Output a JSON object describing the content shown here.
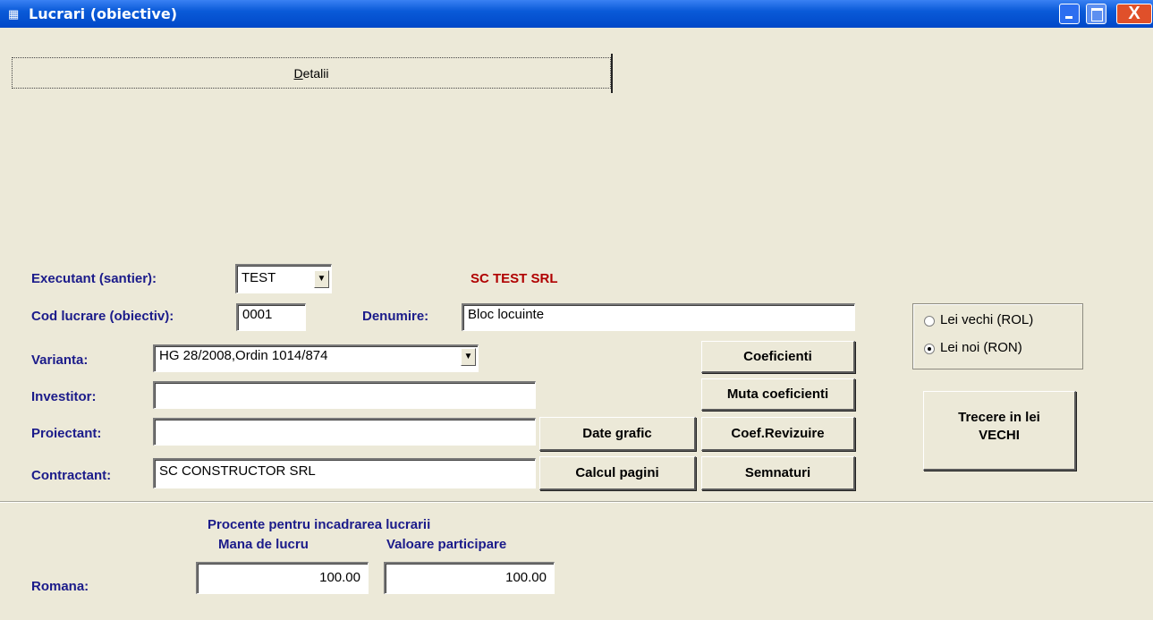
{
  "window": {
    "title": "Lucrari (obiective)",
    "icon": "app-icon",
    "close_glyph": "X"
  },
  "tab": {
    "label": "Detalii"
  },
  "form": {
    "executant_label": "Executant (santier):",
    "executant_value": "TEST",
    "company_name": "SC TEST SRL",
    "cod_label": "Cod lucrare (obiectiv):",
    "cod_value": "0001",
    "denumire_label": "Denumire:",
    "denumire_value": "Bloc locuinte",
    "varianta_label": "Varianta:",
    "varianta_value": "HG 28/2008,Ordin 1014/874",
    "investitor_label": "Investitor:",
    "investitor_value": "",
    "proiectant_label": "Proiectant:",
    "proiectant_value": "",
    "contractant_label": "Contractant:",
    "contractant_value": "SC CONSTRUCTOR SRL"
  },
  "buttons": {
    "coeficienti": "Coeficienti",
    "muta_coeficienti": "Muta coeficienti",
    "date_grafic": "Date grafic",
    "coef_revizuire": "Coef.Revizuire",
    "calcul_pagini": "Calcul pagini",
    "semnaturi": "Semnaturi",
    "trecere_line1": "Trecere in lei",
    "trecere_line2": "VECHI"
  },
  "currency": {
    "options": [
      {
        "label": "Lei vechi (ROL)",
        "selected": false
      },
      {
        "label": "Lei noi (RON)",
        "selected": true
      }
    ]
  },
  "percent": {
    "heading": "Procente pentru incadrarea lucrarii",
    "col1": "Mana de lucru",
    "col2": "Valoare participare",
    "row_label": "Romana:",
    "mana_value": "100.00",
    "valoare_value": "100.00"
  },
  "colors": {
    "title_bar": "#0a5ad8",
    "label_blue": "#1b1b8a",
    "company_red": "#b00000",
    "dialog_bg": "#ece9d8"
  }
}
